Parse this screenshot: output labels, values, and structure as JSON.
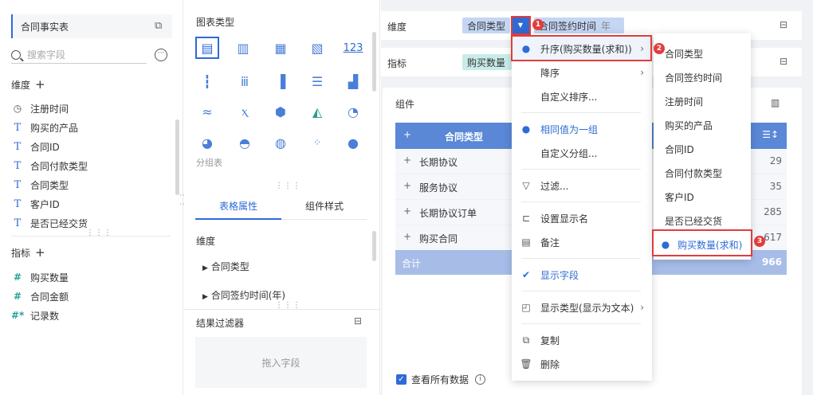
{
  "left": {
    "dataset": "合同事实表",
    "search_placeholder": "搜索字段",
    "dimension_title": "维度",
    "dimensions": [
      {
        "icon": "clock-icon",
        "label": "注册时间"
      },
      {
        "icon": "text-icon",
        "label": "购买的产品"
      },
      {
        "icon": "text-icon",
        "label": "合同ID"
      },
      {
        "icon": "text-icon",
        "label": "合同付款类型"
      },
      {
        "icon": "text-icon",
        "label": "合同类型"
      },
      {
        "icon": "text-icon",
        "label": "客户ID"
      },
      {
        "icon": "text-icon",
        "label": "是否已经交货"
      }
    ],
    "indicator_title": "指标",
    "indicators": [
      {
        "icon": "hash-icon",
        "label": "购买数量"
      },
      {
        "icon": "hash-icon",
        "label": "合同金额"
      },
      {
        "icon": "hash-star-icon",
        "label": "记录数"
      }
    ]
  },
  "mid": {
    "chart_type_title": "图表类型",
    "group_label": "分组表",
    "tabs": [
      "表格属性",
      "组件样式"
    ],
    "dimension_label": "维度",
    "dimension_items": [
      "合同类型",
      "合同签约时间(年)"
    ],
    "filter_title": "结果过滤器",
    "drop_hint": "拖入字段"
  },
  "right": {
    "dimension_label": "维度",
    "dimension_pills": [
      "合同类型",
      "合同签约时间",
      "年"
    ],
    "indicator_label": "指标",
    "indicator_pill": "购买数量",
    "component_label": "组件",
    "table": {
      "header": "合同类型",
      "rows": [
        {
          "label": "长期协议",
          "value": "29"
        },
        {
          "label": "服务协议",
          "value": "35"
        },
        {
          "label": "长期协议订单",
          "value": "285"
        },
        {
          "label": "购买合同",
          "value": "617"
        }
      ],
      "total_label": "合计",
      "total_value": "966"
    },
    "view_all": "查看所有数据"
  },
  "menu": {
    "items": [
      {
        "label": "升序(购买数量(求和))",
        "checked": true,
        "submenu": true
      },
      {
        "label": "降序",
        "submenu": true
      },
      {
        "label": "自定义排序..."
      },
      {
        "label": "相同值为一组",
        "checked": true
      },
      {
        "label": "自定义分组..."
      },
      {
        "label": "过滤..."
      },
      {
        "label": "设置显示名"
      },
      {
        "label": "备注"
      },
      {
        "label": "显示字段"
      },
      {
        "label": "显示类型(显示为文本)",
        "submenu": true
      },
      {
        "label": "复制"
      },
      {
        "label": "删除"
      }
    ]
  },
  "submenu": {
    "items": [
      "合同类型",
      "合同签约时间",
      "注册时间",
      "购买的产品",
      "合同ID",
      "合同付款类型",
      "客户ID",
      "是否已经交货",
      "购买数量(求和)"
    ]
  },
  "badges": [
    "1",
    "2",
    "3"
  ],
  "colors": {
    "accent": "#2e6bd6",
    "highlight": "#e23c3c",
    "table_header": "#5a87d6"
  }
}
